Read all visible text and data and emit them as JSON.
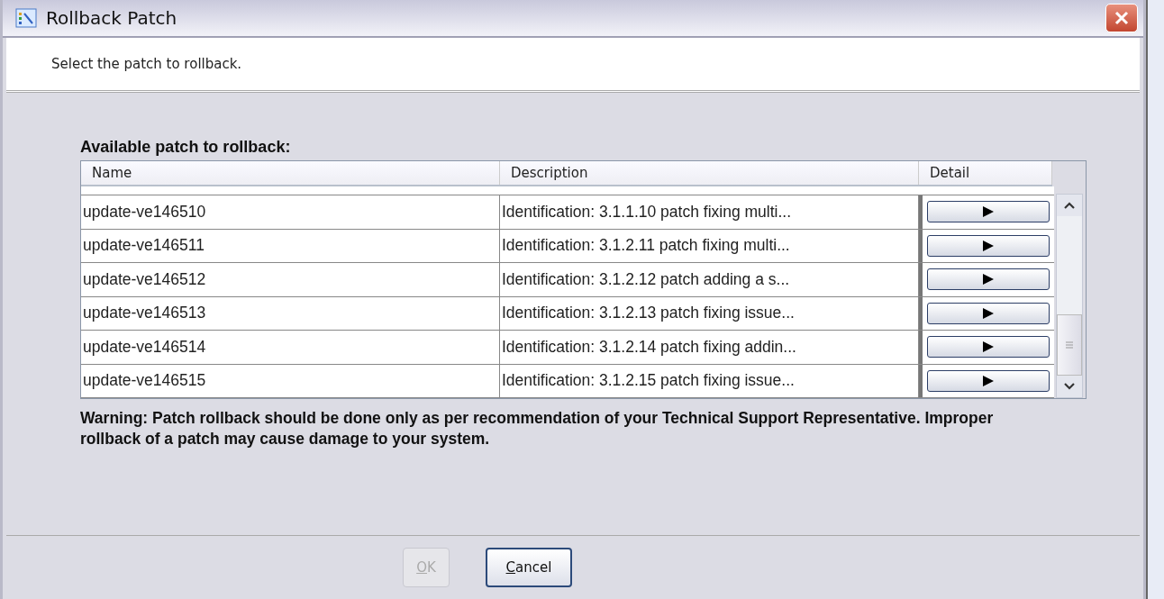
{
  "window": {
    "title": "Rollback Patch"
  },
  "instruction": "Select the patch to rollback.",
  "table_title": "Available patch to rollback:",
  "table": {
    "columns": [
      "Name",
      "Description",
      "Detail"
    ],
    "rows": [
      {
        "name": "update-ve146510",
        "description": "Identification: 3.1.1.10 patch fixing multi..."
      },
      {
        "name": "update-ve146511",
        "description": "Identification: 3.1.2.11 patch fixing multi..."
      },
      {
        "name": "update-ve146512",
        "description": "Identification: 3.1.2.12 patch adding a s..."
      },
      {
        "name": "update-ve146513",
        "description": "Identification: 3.1.2.13 patch fixing issue..."
      },
      {
        "name": "update-ve146514",
        "description": "Identification: 3.1.2.14 patch fixing addin..."
      },
      {
        "name": "update-ve146515",
        "description": "Identification: 3.1.2.15 patch fixing issue..."
      }
    ]
  },
  "warning": "Warning: Patch rollback should be done only as per recommendation of your Technical Support Representative. Improper rollback of a patch may cause damage to your system.",
  "buttons": [
    {
      "label": "OK",
      "disabled": true
    },
    {
      "label": "Cancel",
      "disabled": false
    }
  ]
}
